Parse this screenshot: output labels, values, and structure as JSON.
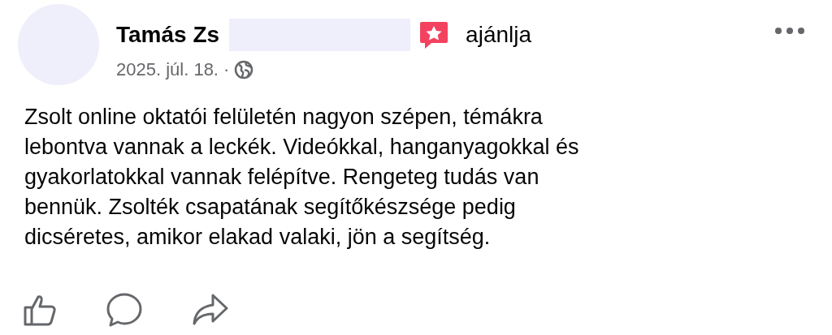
{
  "post": {
    "author": "Tamás Zs",
    "action": "ajánlja",
    "date": "2025. júl. 18. ·",
    "body_lines": [
      "Zsolt online oktatói felületén nagyon szépen, témákra",
      "lebontva vannak a leckék. Videókkal, hanganyagokkal és",
      "gyakorlatokkal vannak felépítve. Rengeteg tudás van",
      "bennük. Zsolték csapatának segítőkészsége pedig",
      "dicséretes, amikor elakad valaki, jön a segítség."
    ]
  }
}
